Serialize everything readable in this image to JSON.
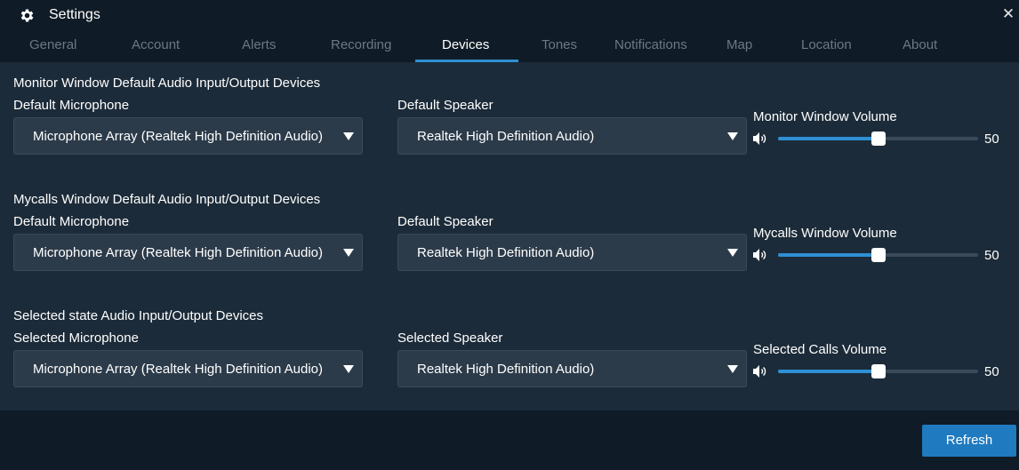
{
  "window": {
    "title": "Settings",
    "title_icon": "gear-icon",
    "close_glyph": "✕"
  },
  "tabs": [
    {
      "label": "General"
    },
    {
      "label": "Account"
    },
    {
      "label": "Alerts"
    },
    {
      "label": "Recording"
    },
    {
      "label": "Devices",
      "active": true
    },
    {
      "label": "Tones"
    },
    {
      "label": "Notifications"
    },
    {
      "label": "Map"
    },
    {
      "label": "Location"
    },
    {
      "label": "About"
    }
  ],
  "sections": [
    {
      "heading": "Monitor Window Default Audio Input/Output Devices",
      "mic_label": "Default Microphone",
      "mic_value": "Microphone Array (Realtek High Definition Audio)",
      "speaker_label": "Default Speaker",
      "speaker_value": "Realtek High Definition Audio)",
      "volume_label": "Monitor Window Volume",
      "volume_value": "50"
    },
    {
      "heading": "Mycalls Window Default Audio Input/Output Devices",
      "mic_label": "Default Microphone",
      "mic_value": "Microphone Array (Realtek High Definition Audio)",
      "speaker_label": "Default Speaker",
      "speaker_value": "Realtek High Definition Audio)",
      "volume_label": "Mycalls Window Volume",
      "volume_value": "50"
    },
    {
      "heading": "Selected state Audio Input/Output Devices",
      "mic_label": "Selected Microphone",
      "mic_value": "Microphone Array (Realtek High Definition Audio)",
      "speaker_label": "Selected Speaker",
      "speaker_value": "Realtek High Definition Audio)",
      "volume_label": "Selected Calls Volume",
      "volume_value": "50"
    }
  ],
  "footer": {
    "refresh_label": "Refresh"
  },
  "colors": {
    "accent": "#2f8fd3",
    "button": "#1f7ac0",
    "background": "#1c2b39",
    "titlebar": "#0f1b26"
  }
}
